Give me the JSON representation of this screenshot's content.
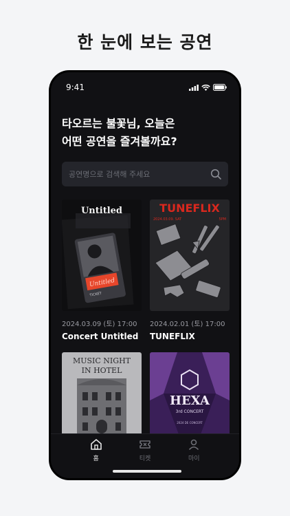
{
  "headline": "한 눈에 보는 공연",
  "status_bar": {
    "time": "9:41"
  },
  "greeting": {
    "line1": "타오르는 불꽃님, 오늘은",
    "line2": "어떤 공연을 즐겨볼까요?"
  },
  "search": {
    "placeholder": "공연명으로 검색해 주세요"
  },
  "concerts": [
    {
      "date": "2024.03.09 (토) 17:00",
      "title": "Concert Untitled",
      "poster_text": "Untitled",
      "badge": "Untitled",
      "ticket": "TICKET"
    },
    {
      "date": "2024.02.01 (토) 17:00",
      "title": "TUNEFLIX",
      "poster_text": "TUNEFLIX",
      "poster_sub_left": "2024.03.09. SAT",
      "poster_sub_right": "5PM"
    },
    {
      "poster_text_line1": "MUSIC NIGHT",
      "poster_text_line2": "IN HOTEL"
    },
    {
      "poster_text": "HEXA",
      "poster_sub": "3rd CONCERT",
      "poster_foot": "2024 DE CONCERT"
    }
  ],
  "tabs": [
    {
      "label": "홈",
      "icon": "home-icon",
      "active": true
    },
    {
      "label": "티켓",
      "icon": "ticket-icon",
      "active": false
    },
    {
      "label": "마이",
      "icon": "person-icon",
      "active": false
    }
  ],
  "colors": {
    "background": "#f4f5f7",
    "phone": "#111114",
    "accent_red": "#e6462b",
    "tuneflix_red": "#d9281e",
    "hexa_purple": "#4b2a6e"
  }
}
